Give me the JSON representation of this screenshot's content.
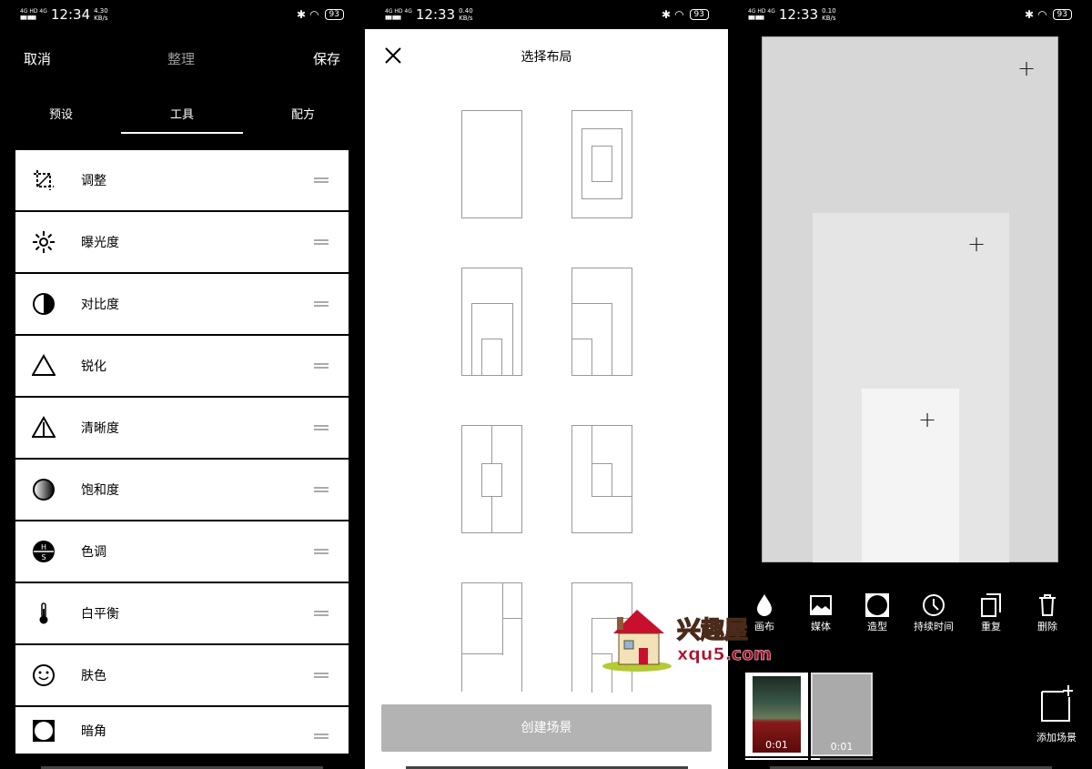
{
  "panel1": {
    "status": {
      "network": "4G HD 4G",
      "time": "12:34",
      "speed": "4.30",
      "speed_unit": "KB/s",
      "battery": "93"
    },
    "header": {
      "cancel": "取消",
      "title": "整理",
      "save": "保存"
    },
    "tabs": [
      {
        "label": "预设"
      },
      {
        "label": "工具",
        "active": true
      },
      {
        "label": "配方"
      }
    ],
    "tools": [
      {
        "label": "调整",
        "icon": "crop-adjust-icon"
      },
      {
        "label": "曝光度",
        "icon": "sun-icon"
      },
      {
        "label": "对比度",
        "icon": "contrast-icon"
      },
      {
        "label": "锐化",
        "icon": "triangle-icon"
      },
      {
        "label": "清晰度",
        "icon": "clarity-triangle-icon"
      },
      {
        "label": "饱和度",
        "icon": "saturation-gradient-icon"
      },
      {
        "label": "色调",
        "icon": "hs-icon",
        "glyph_h": "H",
        "glyph_s": "S"
      },
      {
        "label": "白平衡",
        "icon": "thermometer-icon"
      },
      {
        "label": "肤色",
        "icon": "smiley-icon"
      },
      {
        "label": "暗角",
        "icon": "vignette-icon"
      }
    ]
  },
  "panel2": {
    "status": {
      "network": "4G HD 4G",
      "time": "12:33",
      "speed": "0.40",
      "speed_unit": "KB/s",
      "battery": "93"
    },
    "title": "选择布局",
    "create_button": "创建场景"
  },
  "panel3": {
    "status": {
      "network": "4G HD 4G",
      "time": "12:33",
      "speed": "0.10",
      "speed_unit": "KB/s",
      "battery": "93"
    },
    "toolbar": [
      {
        "label": "画布",
        "icon": "drop-icon"
      },
      {
        "label": "媒体",
        "icon": "image-icon"
      },
      {
        "label": "造型",
        "icon": "shape-icon"
      },
      {
        "label": "持续时间",
        "icon": "clock-icon"
      },
      {
        "label": "重复",
        "icon": "duplicate-icon"
      },
      {
        "label": "删除",
        "icon": "trash-icon"
      }
    ],
    "scenes": [
      {
        "duration": "0:01"
      },
      {
        "duration": "0:01"
      }
    ],
    "add_scene": "添加场景"
  },
  "watermark": {
    "name": "兴趣屋",
    "url": "xqu5.com"
  }
}
